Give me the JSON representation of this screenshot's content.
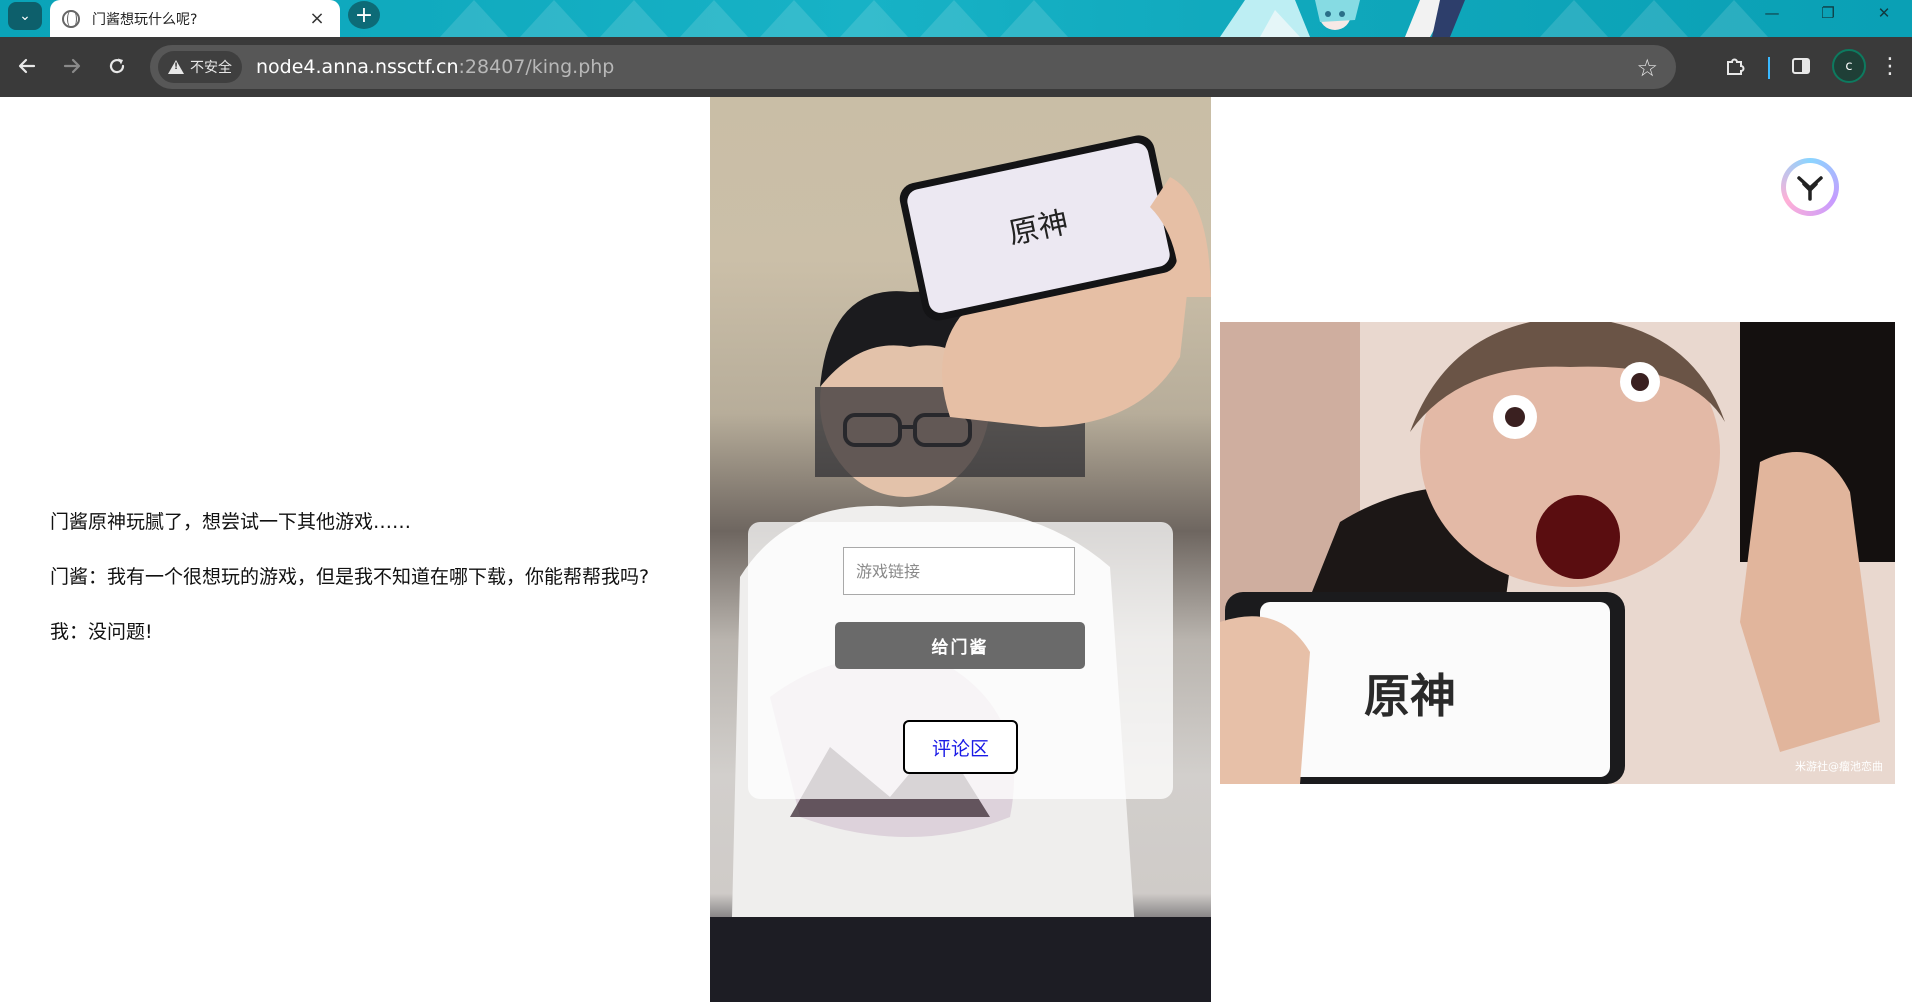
{
  "browser": {
    "tab_title": "门酱想玩什么呢?",
    "tab_close": "×",
    "new_tab": "+",
    "security_label": "不安全",
    "url_host": "node4.anna.nssctf.cn",
    "url_rest": ":28407/king.php",
    "profile_initial": "c",
    "window_controls": [
      "—",
      "❐",
      "✕"
    ]
  },
  "page": {
    "story_lines": [
      "门酱原神玩腻了，想尝试一下其他游戏……",
      "门酱：我有一个很想玩的游戏，但是我不知道在哪下载，你能帮帮我吗?",
      "我：没问题!"
    ],
    "form": {
      "input_placeholder": "游戏链接",
      "submit_label": "给门酱",
      "comment_link_label": "评论区"
    },
    "meme_watermark": "米游社@瘤池恋曲",
    "phone_logo_text": "原神"
  }
}
